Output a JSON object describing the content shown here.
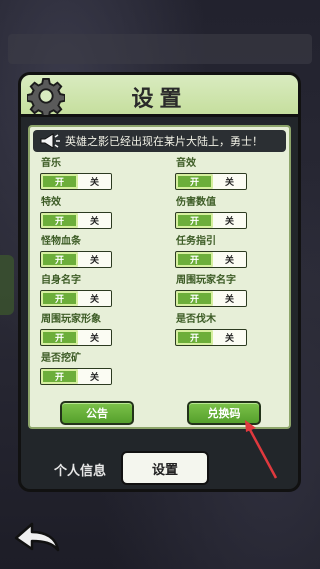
{
  "header": {
    "title": "设置"
  },
  "marquee": {
    "text": "英雄之影已经出现在某片大陆上，勇士！"
  },
  "settings": [
    {
      "label": "音乐",
      "on": "开",
      "off": "关"
    },
    {
      "label": "音效",
      "on": "开",
      "off": "关"
    },
    {
      "label": "特效",
      "on": "开",
      "off": "关"
    },
    {
      "label": "伤害数值",
      "on": "开",
      "off": "关"
    },
    {
      "label": "怪物血条",
      "on": "开",
      "off": "关"
    },
    {
      "label": "任务指引",
      "on": "开",
      "off": "关"
    },
    {
      "label": "自身名字",
      "on": "开",
      "off": "关"
    },
    {
      "label": "周围玩家名字",
      "on": "开",
      "off": "关"
    },
    {
      "label": "周围玩家形象",
      "on": "开",
      "off": "关"
    },
    {
      "label": "是否伐木",
      "on": "开",
      "off": "关"
    },
    {
      "label": "是否挖矿",
      "on": "开",
      "off": "关"
    }
  ],
  "buttons": {
    "announcement": "公告",
    "redeem": "兑换码"
  },
  "tabs": {
    "personal": "个人信息",
    "settings": "设置"
  },
  "colors": {
    "accent_green": "#6cae3a",
    "header_bg": "#d9ebc0",
    "arrow_red": "#e0393e"
  },
  "icons": {
    "settings": "gear-icon",
    "marquee": "megaphone-icon",
    "back": "back-arrow-icon"
  }
}
